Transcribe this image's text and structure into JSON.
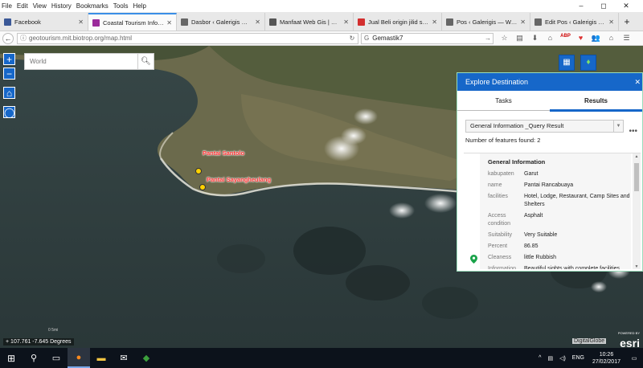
{
  "menu": [
    "File",
    "Edit",
    "View",
    "History",
    "Bookmarks",
    "Tools",
    "Help"
  ],
  "window_controls": [
    "–",
    "◻",
    "✕"
  ],
  "tabs": [
    {
      "title": "Facebook",
      "color": "#3b5998",
      "active": false
    },
    {
      "title": "Coastal Tourism Infor...",
      "color": "#9b2b9b",
      "active": true
    },
    {
      "title": "Dasbor ‹ Galerigis — Wor...",
      "color": "#666666",
      "active": false
    },
    {
      "title": "Manfaat Web Gis | Ga...",
      "color": "#555555",
      "active": false
    },
    {
      "title": "Jual Beli origin jilid sp...",
      "color": "#d32f2f",
      "active": false
    },
    {
      "title": "Pos ‹ Galerigis — WordPr...",
      "color": "#666666",
      "active": false
    },
    {
      "title": "Edit Pos ‹ Galerigis — Wo...",
      "color": "#666666",
      "active": false
    }
  ],
  "new_tab": "+",
  "nav": {
    "url": "geotourism.mit.biotrop.org/map.html",
    "search_value": "Gemastik7"
  },
  "toolbar_icons": [
    "☆",
    "▤",
    "⬇",
    "⌂",
    "ABP",
    "♥",
    "👥",
    "⌂",
    "☰"
  ],
  "map": {
    "search_placeholder": "World",
    "zoom_in": "+",
    "zoom_out": "−",
    "labels": {
      "santolo": "Pantai Santolo",
      "sayang": "Pantai Sayangheulang"
    },
    "coords": "107.761 -7.645 Degrees",
    "attribution": "DigitalGlobe",
    "esri_small": "POWERED BY",
    "esri": "esri",
    "scale": "0 5mi"
  },
  "panel": {
    "title": "Explore Destination",
    "close": "✕",
    "tabs": [
      "Tasks",
      "Results"
    ],
    "query": "General Information _Query Result",
    "more": "•••",
    "count_text": "Number of features found: 2",
    "result_title": "General Information",
    "attributes": [
      {
        "k": "kabupaten",
        "v": "Garut"
      },
      {
        "k": "name",
        "v": "Pantai Rancabuaya"
      },
      {
        "k": "facilities",
        "v": "Hotel, Lodge, Restaurant, Camp Sites and Shelters"
      },
      {
        "k": "Access condition",
        "v": "Asphalt"
      },
      {
        "k": "Suitability",
        "v": "Very Suitable"
      },
      {
        "k": "Percent",
        "v": "86.85"
      },
      {
        "k": "Cleaness",
        "v": "little Rubbish"
      },
      {
        "k": "Information",
        "v": "Beautiful sights with complete facilities"
      }
    ]
  },
  "taskbar": {
    "lang": "ENG",
    "time": "10:26",
    "date": "27/02/2017"
  }
}
